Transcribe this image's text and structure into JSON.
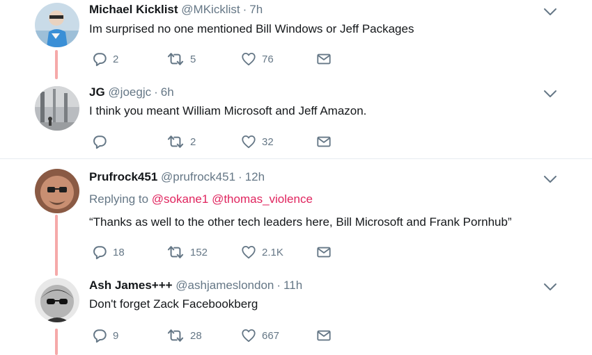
{
  "tweets": [
    {
      "name": "Michael Kicklist",
      "handle": "@MKicklist",
      "separator": "·",
      "time": "7h",
      "text": "Im surprised no one mentioned Bill Windows or Jeff Packages",
      "counts": {
        "reply": "2",
        "retweet": "5",
        "like": "76"
      }
    },
    {
      "name": "JG",
      "handle": "@joegjc",
      "separator": "·",
      "time": "6h",
      "text": "I think you meant William Microsoft and Jeff Amazon.",
      "counts": {
        "reply": "",
        "retweet": "2",
        "like": "32"
      }
    },
    {
      "name": "Prufrock451",
      "handle": "@prufrock451",
      "separator": "·",
      "time": "12h",
      "replying_prefix": "Replying to",
      "replying_to": [
        "@sokane1",
        "@thomas_violence"
      ],
      "text": "“Thanks as well to the other tech leaders here, Bill Microsoft and Frank Pornhub”",
      "counts": {
        "reply": "18",
        "retweet": "152",
        "like": "2.1K"
      }
    },
    {
      "name": "Ash James+++",
      "handle": "@ashjameslondon",
      "separator": "·",
      "time": "11h",
      "text": "Don't forget Zack Facebookberg",
      "counts": {
        "reply": "9",
        "retweet": "28",
        "like": "667"
      }
    }
  ],
  "icons": {
    "reply": "reply-icon",
    "retweet": "retweet-icon",
    "like": "heart-icon",
    "dm": "envelope-icon",
    "more": "chevron-down-icon"
  },
  "colors": {
    "name": "#14171a",
    "muted": "#657786",
    "mention": "#e0245e",
    "thread_line": "#f5a9a9",
    "separator": "#e6ecf0"
  }
}
